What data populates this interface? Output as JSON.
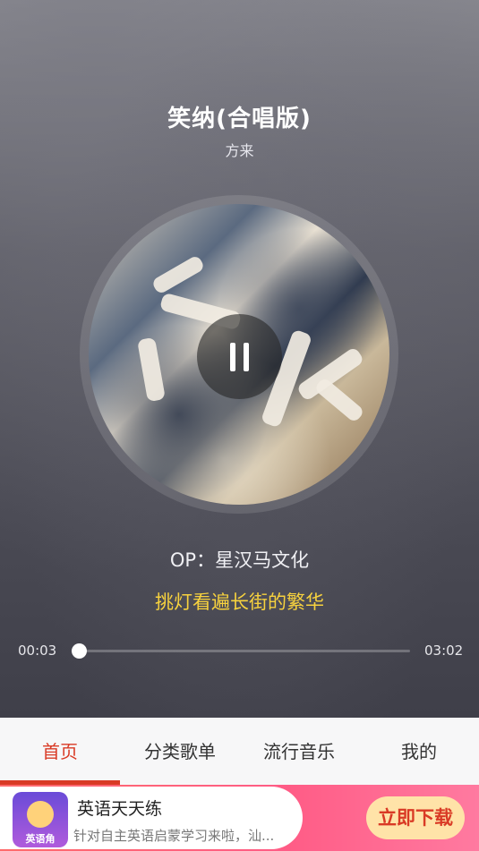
{
  "song": {
    "title": "笑纳(合唱版)",
    "artist": "方来"
  },
  "lyrics": {
    "credit_line": "OP：星汉马文化",
    "current_line": "挑灯看遍长街的繁华"
  },
  "player": {
    "current_time": "00:03",
    "total_time": "03:02",
    "progress_fraction": 0.02,
    "state": "playing",
    "pause_icon": "pause-icon"
  },
  "nav": {
    "tabs": [
      {
        "label": "首页",
        "active": true
      },
      {
        "label": "分类歌单",
        "active": false
      },
      {
        "label": "流行音乐",
        "active": false
      },
      {
        "label": "我的",
        "active": false
      }
    ],
    "active_color": "#d93a25"
  },
  "ad": {
    "title": "英语天天练",
    "description": "针对自主英语启蒙学习来啦，汕...",
    "cta": "立即下载",
    "logo_text": "英语角"
  }
}
